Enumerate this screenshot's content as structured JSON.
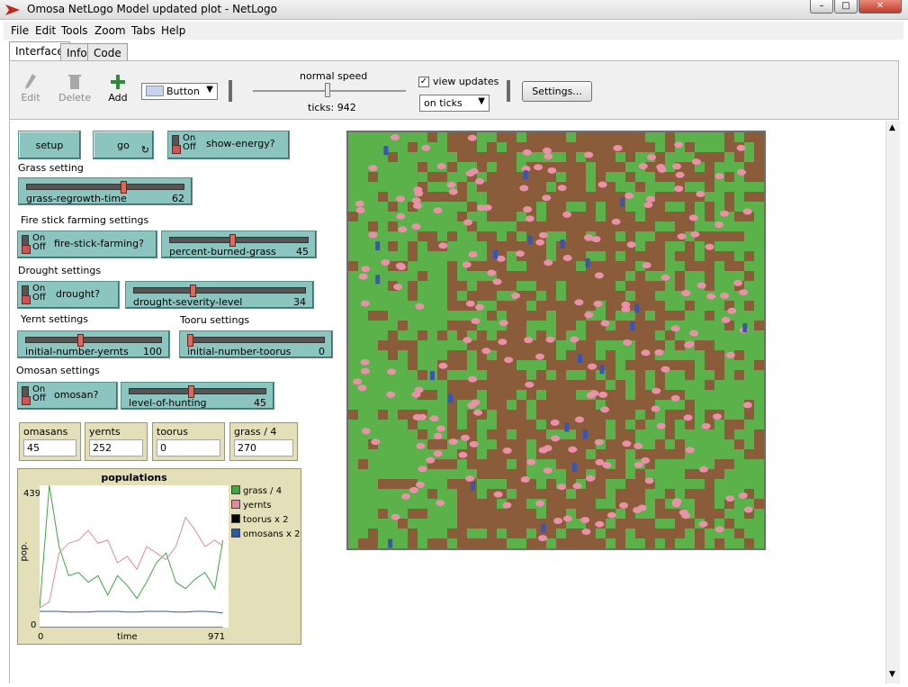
{
  "window": {
    "title": "Omosa NetLogo Model updated plot - NetLogo",
    "minimize": "–",
    "maximize": "□",
    "close": "✕"
  },
  "menu": [
    "File",
    "Edit",
    "Tools",
    "Zoom",
    "Tabs",
    "Help"
  ],
  "tabs": [
    "Interface",
    "Info",
    "Code"
  ],
  "toolbar": {
    "edit": "Edit",
    "delete": "Delete",
    "add": "Add",
    "widget_type": "Button",
    "speed_label": "normal speed",
    "ticks_label": "ticks: 942",
    "view_updates_label": "view updates",
    "view_updates_checked": true,
    "update_mode": "on ticks",
    "settings": "Settings..."
  },
  "buttons": {
    "setup": "setup",
    "go": "go",
    "go_forever_icon": "↻"
  },
  "switch_text": {
    "on": "On",
    "off": "Off"
  },
  "sections": {
    "grass": "Grass setting",
    "fire": "Fire stick farming settings",
    "drought": "Drought settings",
    "yernt": "Yernt settings",
    "tooru": "Tooru settings",
    "omosan": "Omosan settings"
  },
  "switches": {
    "show_energy": "show-energy?",
    "fire_stick": "fire-stick-farming?",
    "drought": "drought?",
    "omosan": "omosan?"
  },
  "sliders": {
    "grass_regrowth": {
      "name": "grass-regrowth-time",
      "value": "62",
      "fraction": 0.62
    },
    "percent_burned": {
      "name": "percent-burned-grass",
      "value": "45",
      "fraction": 0.45
    },
    "drought_severity": {
      "name": "drought-severity-level",
      "value": "34",
      "fraction": 0.34
    },
    "initial_yernts": {
      "name": "initial-number-yernts",
      "value": "100",
      "fraction": 0.4
    },
    "initial_toorus": {
      "name": "initial-number-toorus",
      "value": "0",
      "fraction": 0.0
    },
    "level_hunting": {
      "name": "level-of-hunting",
      "value": "45",
      "fraction": 0.45
    }
  },
  "monitors": [
    {
      "name": "omasans",
      "value": "45"
    },
    {
      "name": "yernts",
      "value": "252"
    },
    {
      "name": "toorus",
      "value": "0"
    },
    {
      "name": "grass / 4",
      "value": "270"
    }
  ],
  "plot": {
    "title": "populations",
    "y_max": "439",
    "y_min": "0",
    "x_min": "0",
    "x_max": "971",
    "y_label": "pop.",
    "x_label": "time"
  },
  "chart_data": {
    "type": "line",
    "title": "populations",
    "xlabel": "time",
    "ylabel": "pop.",
    "xlim": [
      0,
      971
    ],
    "ylim": [
      0,
      439
    ],
    "x": [
      0,
      50,
      100,
      150,
      200,
      250,
      300,
      350,
      400,
      450,
      500,
      550,
      600,
      650,
      700,
      750,
      800,
      850,
      900,
      942
    ],
    "series": [
      {
        "name": "grass / 4",
        "color": "#3da83d",
        "values": [
          60,
          439,
          250,
          160,
          170,
          140,
          160,
          100,
          160,
          130,
          90,
          140,
          200,
          230,
          140,
          120,
          150,
          170,
          120,
          270
        ]
      },
      {
        "name": "yernts",
        "color": "#e08aa0",
        "values": [
          60,
          80,
          230,
          260,
          270,
          300,
          260,
          270,
          200,
          220,
          180,
          250,
          230,
          210,
          250,
          340,
          300,
          250,
          270,
          252
        ]
      },
      {
        "name": "toorus x 2",
        "color": "#000000",
        "values": [
          0,
          0,
          0,
          0,
          0,
          0,
          0,
          0,
          0,
          0,
          0,
          0,
          0,
          0,
          0,
          0,
          0,
          0,
          0,
          0
        ]
      },
      {
        "name": "omosans x 2",
        "color": "#2c5aa0",
        "values": [
          50,
          50,
          50,
          48,
          48,
          48,
          50,
          50,
          50,
          48,
          48,
          50,
          50,
          50,
          48,
          48,
          50,
          50,
          48,
          45
        ]
      }
    ]
  }
}
